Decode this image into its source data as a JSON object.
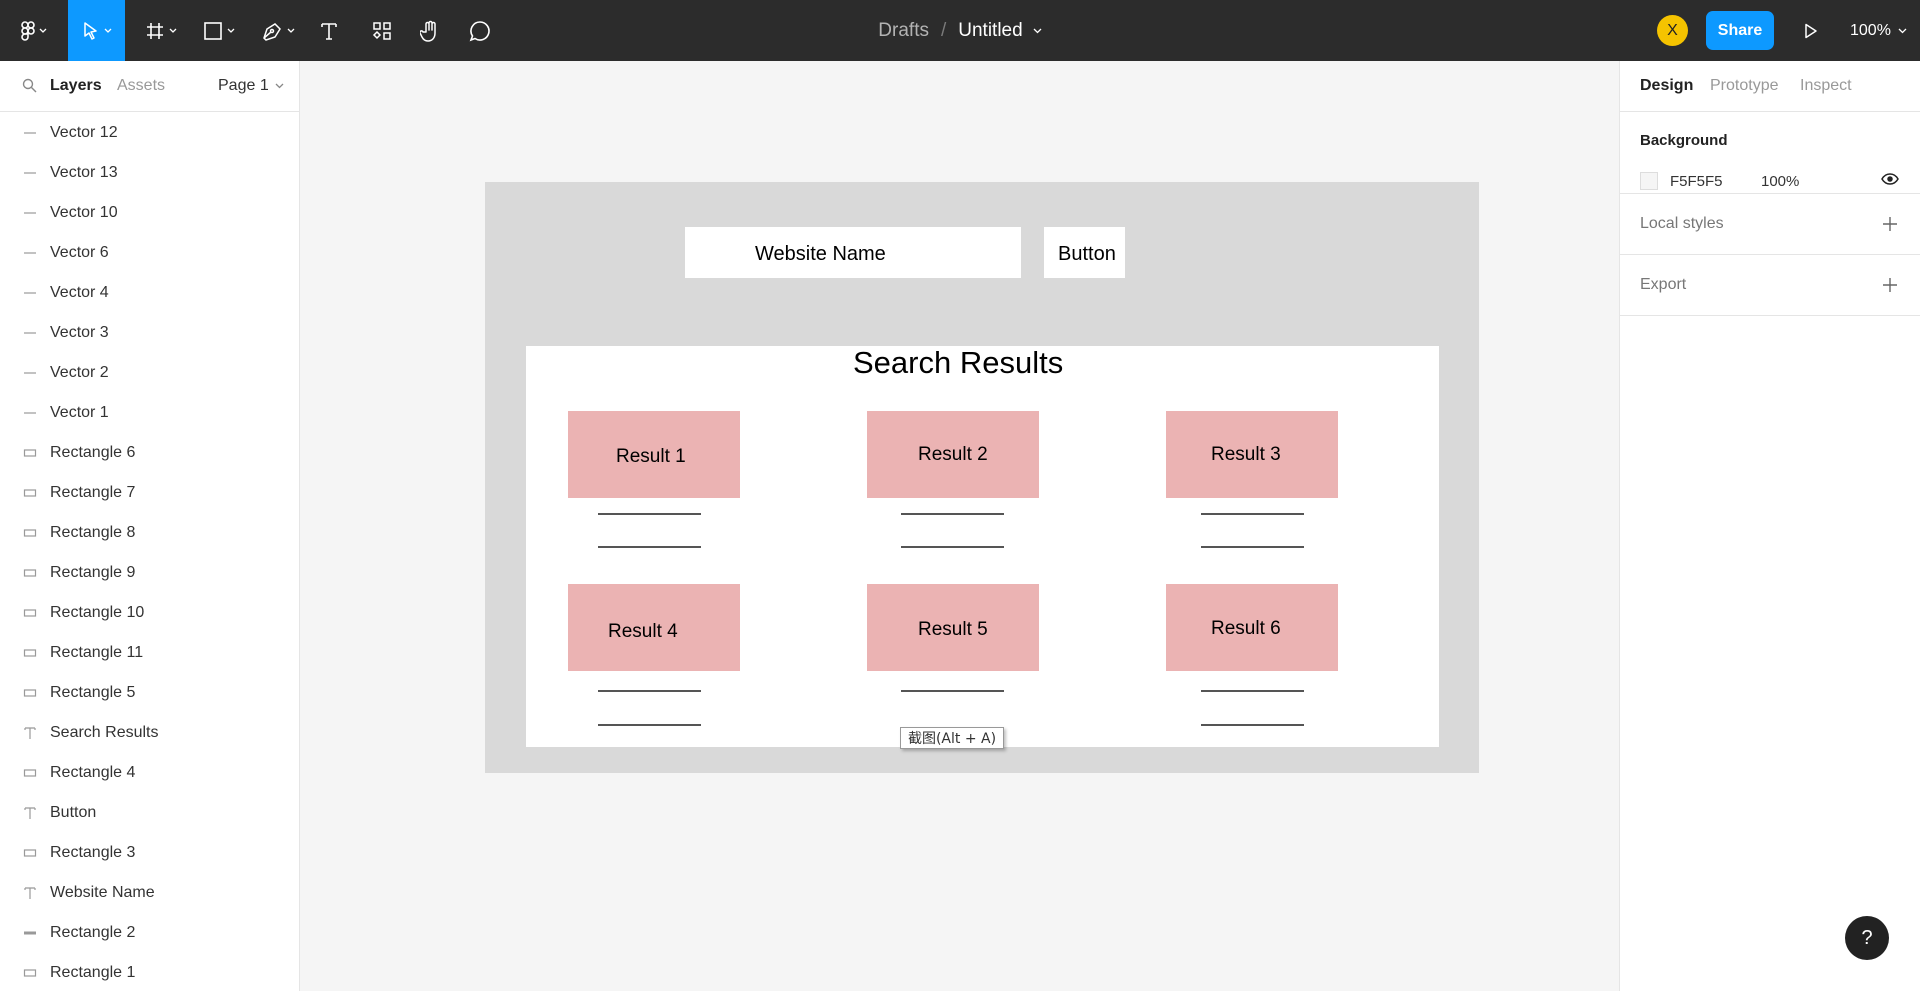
{
  "toolbar": {
    "breadcrumb_folder": "Drafts",
    "breadcrumb_separator": "/",
    "file_title": "Untitled",
    "avatar_initial": "X",
    "share_label": "Share",
    "zoom_label": "100%"
  },
  "left_panel": {
    "tab_layers": "Layers",
    "tab_assets": "Assets",
    "page_label": "Page 1",
    "layers": [
      {
        "name": "Vector 12",
        "icon": "line-icon"
      },
      {
        "name": "Vector 13",
        "icon": "line-icon"
      },
      {
        "name": "Vector 10",
        "icon": "line-icon"
      },
      {
        "name": "Vector 6",
        "icon": "line-icon"
      },
      {
        "name": "Vector 4",
        "icon": "line-icon"
      },
      {
        "name": "Vector 3",
        "icon": "line-icon"
      },
      {
        "name": "Vector 2",
        "icon": "line-icon"
      },
      {
        "name": "Vector 1",
        "icon": "line-icon"
      },
      {
        "name": "Rectangle 6",
        "icon": "rectangle-icon"
      },
      {
        "name": "Rectangle 7",
        "icon": "rectangle-icon"
      },
      {
        "name": "Rectangle 8",
        "icon": "rectangle-icon"
      },
      {
        "name": "Rectangle 9",
        "icon": "rectangle-icon"
      },
      {
        "name": "Rectangle 10",
        "icon": "rectangle-icon"
      },
      {
        "name": "Rectangle 11",
        "icon": "rectangle-icon"
      },
      {
        "name": "Rectangle 5",
        "icon": "rectangle-icon"
      },
      {
        "name": "Search Results",
        "icon": "text-icon"
      },
      {
        "name": "Rectangle 4",
        "icon": "rectangle-icon"
      },
      {
        "name": "Button",
        "icon": "text-icon"
      },
      {
        "name": "Rectangle 3",
        "icon": "rectangle-icon"
      },
      {
        "name": "Website Name",
        "icon": "text-icon"
      },
      {
        "name": "Rectangle 2",
        "icon": "flat-rectangle-icon"
      },
      {
        "name": "Rectangle 1",
        "icon": "rectangle-icon"
      }
    ]
  },
  "right_panel": {
    "tab_design": "Design",
    "tab_prototype": "Prototype",
    "tab_inspect": "Inspect",
    "background_title": "Background",
    "background_hex": "F5F5F5",
    "background_opacity": "100%",
    "local_styles_label": "Local styles",
    "export_label": "Export"
  },
  "canvas": {
    "website_name": "Website Name",
    "button_text": "Button",
    "results_title": "Search Results",
    "results": [
      "Result 1",
      "Result 2",
      "Result 3",
      "Result 4",
      "Result 5",
      "Result 6"
    ],
    "tooltip": "截图(Alt + A)"
  },
  "help_label": "?",
  "colors": {
    "toolbar_bg": "#2c2c2c",
    "accent": "#0d99ff",
    "avatar": "#f5c300",
    "frame_bg": "#d9d9d9",
    "result_card": "#ebb3b3",
    "canvas_bg": "#f5f5f5"
  }
}
